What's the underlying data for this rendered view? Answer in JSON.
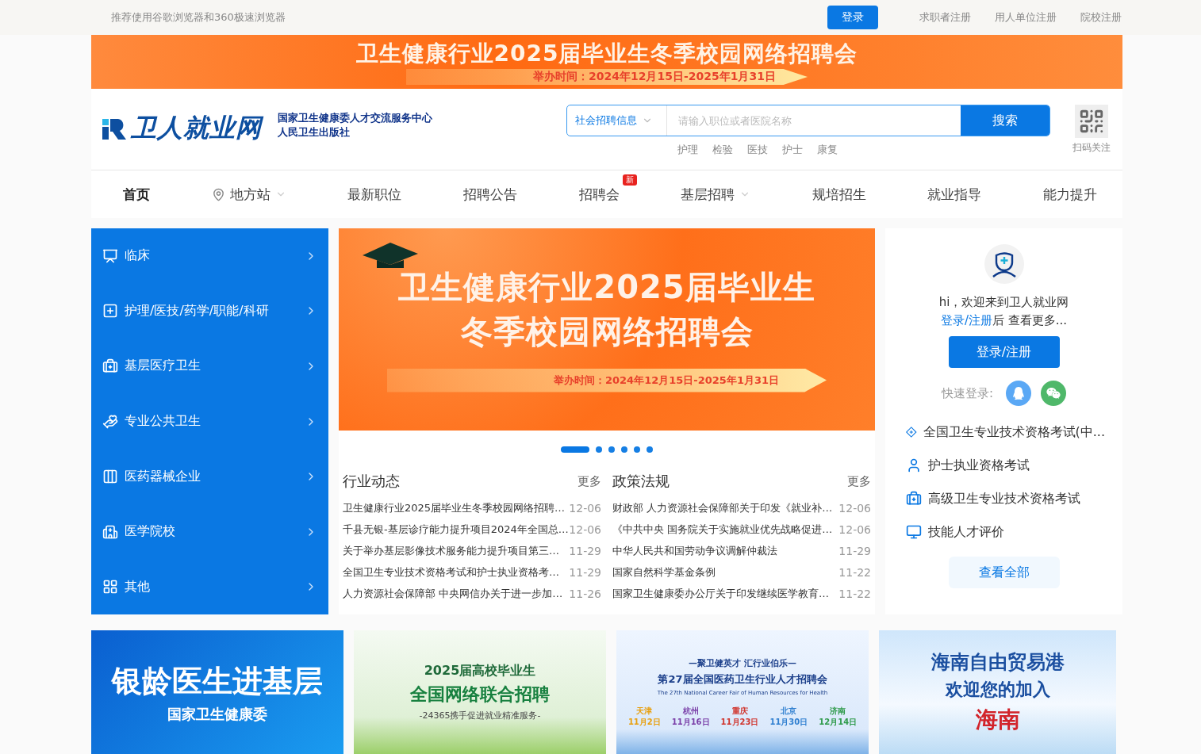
{
  "top_bar": {
    "notice": "推荐使用谷歌浏览器和360极速浏览器",
    "login_button": "登录",
    "links": [
      "求职者注册",
      "用人单位注册",
      "院校注册"
    ]
  },
  "top_banner": {
    "title": "卫生健康行业2025届毕业生冬季校园网络招聘会",
    "date": "举办时间：2024年12月15日-2025年1月31日"
  },
  "header": {
    "logo": "卫人就业网",
    "org_lines": [
      "国家卫生健康委人才交流服务中心",
      "人民卫生出版社"
    ],
    "search": {
      "category": "社会招聘信息",
      "placeholder": "请输入职位或者医院名称",
      "button": "搜索"
    },
    "hot_keywords": [
      "护理",
      "检验",
      "医技",
      "护士",
      "康复"
    ],
    "qr_label": "扫码关注"
  },
  "nav": {
    "items": [
      {
        "label": "首页",
        "selected": true,
        "kind": "plain"
      },
      {
        "label": "地方站",
        "selected": false,
        "kind": "station"
      },
      {
        "label": "最新职位",
        "selected": false,
        "kind": "plain"
      },
      {
        "label": "招聘公告",
        "selected": false,
        "kind": "plain"
      },
      {
        "label": "招聘会",
        "selected": false,
        "kind": "plain",
        "badge": "新"
      },
      {
        "label": "基层招聘",
        "selected": false,
        "kind": "dropdown"
      },
      {
        "label": "规培招生",
        "selected": false,
        "kind": "plain"
      },
      {
        "label": "就业指导",
        "selected": false,
        "kind": "plain"
      },
      {
        "label": "能力提升",
        "selected": false,
        "kind": "plain"
      }
    ]
  },
  "categories": [
    {
      "label": "临床"
    },
    {
      "label": "护理/医技/药学/职能/科研"
    },
    {
      "label": "基层医疗卫生"
    },
    {
      "label": "专业公共卫生"
    },
    {
      "label": "医药器械企业"
    },
    {
      "label": "医学院校"
    },
    {
      "label": "其他"
    }
  ],
  "carousel": {
    "title_lines": [
      "卫生健康行业2025届毕业生",
      "冬季校园网络招聘会"
    ],
    "date": "举办时间：2024年12月15日-2025年1月31日",
    "slides": [
      {
        "selected": true
      },
      {
        "selected": false
      },
      {
        "selected": false
      },
      {
        "selected": false
      },
      {
        "selected": false
      },
      {
        "selected": false
      }
    ]
  },
  "news_columns": [
    {
      "title": "行业动态",
      "more": "更多",
      "items": [
        {
          "title": "卫生健康行业2025届毕业生冬季校园网络招聘…",
          "date": "12-06"
        },
        {
          "title": "千县无银-基层诊疗能力提升项目2024年全国总…",
          "date": "12-06"
        },
        {
          "title": "关于举办基层影像技术服务能力提升项目第三…",
          "date": "11-29"
        },
        {
          "title": "全国卫生专业技术资格考试和护士执业资格考…",
          "date": "11-29"
        },
        {
          "title": "人力资源社会保障部 中央网信办关于进一步加…",
          "date": "11-26"
        }
      ]
    },
    {
      "title": "政策法规",
      "more": "更多",
      "items": [
        {
          "title": "财政部 人力资源社会保障部关于印发《就业补…",
          "date": "12-06"
        },
        {
          "title": "《中共中央 国务院关于实施就业优先战略促进…",
          "date": "12-06"
        },
        {
          "title": "中华人民共和国劳动争议调解仲裁法",
          "date": "11-29"
        },
        {
          "title": "国家自然科学基金条例",
          "date": "11-22"
        },
        {
          "title": "国家卫生健康委办公厅关于印发继续医学教育…",
          "date": "11-22"
        }
      ]
    }
  ],
  "user_panel": {
    "greeting": "hi，欢迎来到卫人就业网",
    "login_link": "登录/注册",
    "after_link": "后 查看更多...",
    "button": "登录/注册",
    "quick_login_label": "快速登录:",
    "links": [
      {
        "label": "全国卫生专业技术资格考试(中..."
      },
      {
        "label": "护士执业资格考试"
      },
      {
        "label": "高级卫生专业技术资格考试"
      },
      {
        "label": "技能人才评价"
      }
    ],
    "view_all": "查看全部"
  },
  "promo_cards": [
    {
      "kind": "silver",
      "lines": [
        "银龄医生进基层",
        "国家卫生健康委"
      ]
    },
    {
      "kind": "green",
      "lines": [
        "2025届高校毕业生",
        "全国网络联合招聘",
        "-24365携手促进就业精准服务-"
      ]
    },
    {
      "kind": "fair",
      "lines": [
        "—聚卫健英才 汇行业伯乐—",
        "第27届全国医药卫生行业人才招聘会",
        "The 27th National Career Fair of Human Resources for Health"
      ],
      "cities": [
        {
          "city": "天津",
          "date": "11月2日",
          "color": "#e8a010"
        },
        {
          "city": "杭州",
          "date": "11月16日",
          "color": "#7a3fa8"
        },
        {
          "city": "重庆",
          "date": "11月23日",
          "color": "#d0342c"
        },
        {
          "city": "北京",
          "date": "11月30日",
          "color": "#2f7fd0"
        },
        {
          "city": "济南",
          "date": "12月14日",
          "color": "#2e9a4a"
        }
      ]
    },
    {
      "kind": "hainan",
      "lines": [
        "海南自由贸易港",
        "欢迎您的加入",
        "海南"
      ]
    }
  ]
}
